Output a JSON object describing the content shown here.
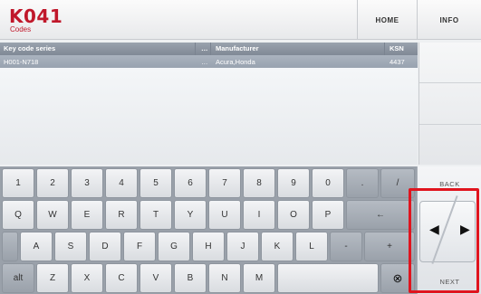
{
  "header": {
    "title": "K041",
    "subtitle": "Codes",
    "home_label": "HOME",
    "info_label": "INFO"
  },
  "table": {
    "columns": [
      "Key code series",
      "…",
      "Manufacturer",
      "KSN"
    ],
    "rows": [
      {
        "series": "H001-N718",
        "sep": "…",
        "manufacturer": "Acura,Honda",
        "ksn": "4437"
      }
    ]
  },
  "keyboard": {
    "row1": [
      "1",
      "2",
      "3",
      "4",
      "5",
      "6",
      "7",
      "8",
      "9",
      "0",
      ".",
      "/"
    ],
    "row2": [
      "Q",
      "W",
      "E",
      "R",
      "T",
      "Y",
      "U",
      "I",
      "O",
      "P",
      "←"
    ],
    "row3": [
      "A",
      "S",
      "D",
      "F",
      "G",
      "H",
      "J",
      "K",
      "L",
      "-",
      "+"
    ],
    "row4": [
      "alt",
      "Z",
      "X",
      "C",
      "V",
      "B",
      "N",
      "M",
      "",
      "⊗"
    ]
  },
  "side_nav": {
    "back_label": "BACK",
    "next_label": "NEXT",
    "left_arrow": "◀",
    "right_arrow": "▶"
  },
  "colors": {
    "brand": "#c0182b",
    "highlight": "#e0141e",
    "table_header": "#8a939f"
  }
}
